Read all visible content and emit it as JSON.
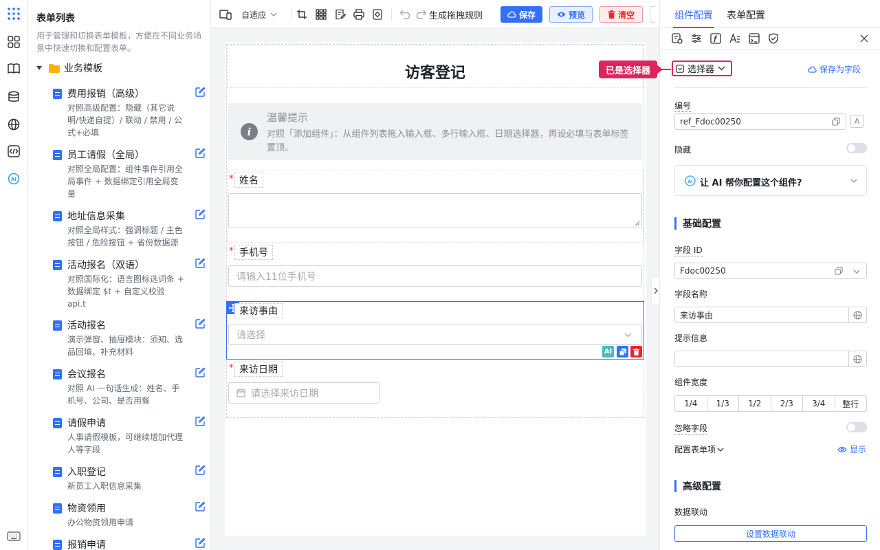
{
  "sidebar": {
    "title": "表单列表",
    "description": "用于管理和切换表单模板，方便在不同业务场景中快速切换和配置表单。",
    "folder": "业务模板",
    "templates": [
      {
        "name": "费用报销（高级）",
        "desc": "对照高级配置：隐藏（其它说明/快递自提）/ 联动 / 禁用 / 公式+必填"
      },
      {
        "name": "员工请假（全局）",
        "desc": "对照全局配置：组件事件引用全局事件 + 数据绑定引用全局变量"
      },
      {
        "name": "地址信息采集",
        "desc": "对照全局样式：强调标题 / 主色按钮 / 危险按钮 + 省份数据源"
      },
      {
        "name": "活动报名（双语）",
        "desc": "对照国际化：语言图标选词条 + 数据绑定 $t + 自定义校验 api.t"
      },
      {
        "name": "活动报名",
        "desc": "演示弹窗、抽屉模块：须知、选品回填、补充材料"
      },
      {
        "name": "会议报名",
        "desc": "对照 AI 一句话生成：姓名、手机号、公司、是否用餐"
      },
      {
        "name": "请假申请",
        "desc": "人事请假模板，可继续增加代理人等字段"
      },
      {
        "name": "入职登记",
        "desc": "新员工入职信息采集"
      },
      {
        "name": "物资领用",
        "desc": "办公物资领用申请"
      },
      {
        "name": "报销申请",
        "desc": ""
      }
    ]
  },
  "toolbar": {
    "adaptive": "自适应",
    "rules": "生成拖拽规则",
    "save": "保存",
    "preview": "预览",
    "clear": "清空"
  },
  "form": {
    "title": "访客登记",
    "tip_title": "温馨提示",
    "tip_text": "对照「添加组件」：从组件列表拖入输入框、多行输入框、日期选择器，再设必填与表单标签置顶。",
    "required_mark": "*",
    "fields": {
      "name": {
        "label": "姓名"
      },
      "phone": {
        "label": "手机号",
        "placeholder": "请输入11位手机号"
      },
      "reason": {
        "label": "来访事由",
        "placeholder": "请选择"
      },
      "date": {
        "label": "来访日期",
        "placeholder": "请选择来访日期"
      }
    },
    "ai_tag": "AI"
  },
  "panel": {
    "tabs": [
      "组件配置",
      "表单配置"
    ],
    "callout": "已是选择器",
    "component_type": "选择器",
    "save_as_field": "保存为字段",
    "ref_label": "编号",
    "ref_value": "ref_Fdoc00250",
    "hidden_label": "隐藏",
    "ai_prompt": "让 AI 帮你配置这个组件?",
    "ai_badge": "AI",
    "basic_title": "基础配置",
    "field_id_label": "字段 ID",
    "field_id_value": "Fdoc00250",
    "field_name_label": "字段名称",
    "field_name_value": "来访事由",
    "hint_label": "提示信息",
    "hint_value": "",
    "width_label": "组件宽度",
    "widths": [
      "1/4",
      "1/3",
      "1/2",
      "2/3",
      "3/4",
      "整行"
    ],
    "ignore_label": "忽略字段",
    "config_items_label": "配置表单项",
    "show_label": "显示",
    "advanced_title": "高级配置",
    "linkage_label": "数据联动",
    "linkage_button": "设置数据联动"
  },
  "colors": {
    "primary": "#3370ff",
    "danger": "#f5222d",
    "callout": "#e0245e"
  }
}
